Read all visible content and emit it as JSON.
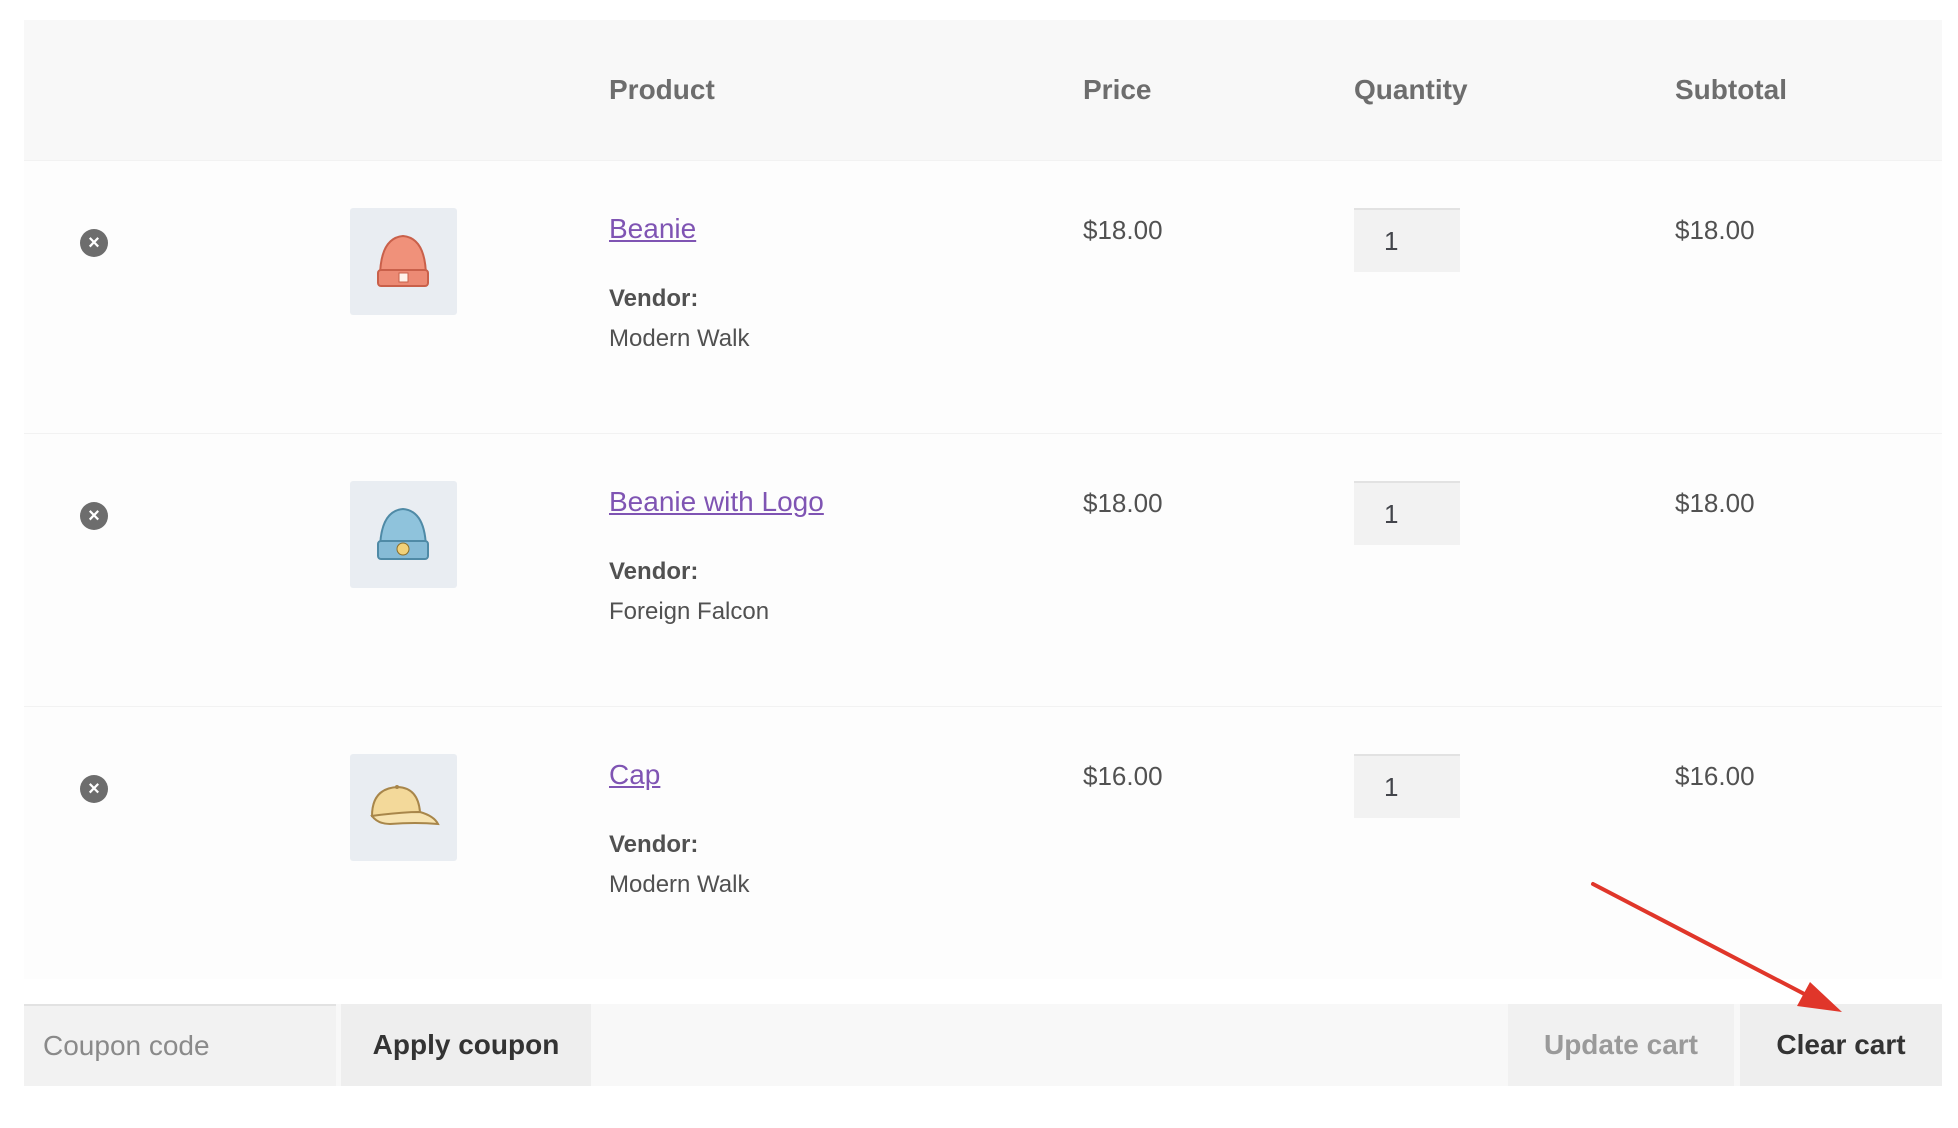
{
  "table": {
    "headers": {
      "product": "Product",
      "price": "Price",
      "quantity": "Quantity",
      "subtotal": "Subtotal"
    },
    "rows": [
      {
        "name": "Beanie",
        "vendor_label": "Vendor:",
        "vendor": "Modern Walk",
        "price": "$18.00",
        "quantity": "1",
        "subtotal": "$18.00",
        "thumbnail": "beanie-orange"
      },
      {
        "name": "Beanie with Logo",
        "vendor_label": "Vendor:",
        "vendor": "Foreign Falcon",
        "price": "$18.00",
        "quantity": "1",
        "subtotal": "$18.00",
        "thumbnail": "beanie-blue-logo"
      },
      {
        "name": "Cap",
        "vendor_label": "Vendor:",
        "vendor": "Modern Walk",
        "price": "$16.00",
        "quantity": "1",
        "subtotal": "$16.00",
        "thumbnail": "cap-yellow"
      }
    ]
  },
  "actions": {
    "coupon_placeholder": "Coupon code",
    "apply_coupon": "Apply coupon",
    "update_cart": "Update cart",
    "clear_cart": "Clear cart"
  },
  "colors": {
    "link": "#7f54b3",
    "annotation_arrow": "#e0362a"
  },
  "icons": {
    "remove": "remove-circle-x-icon"
  }
}
